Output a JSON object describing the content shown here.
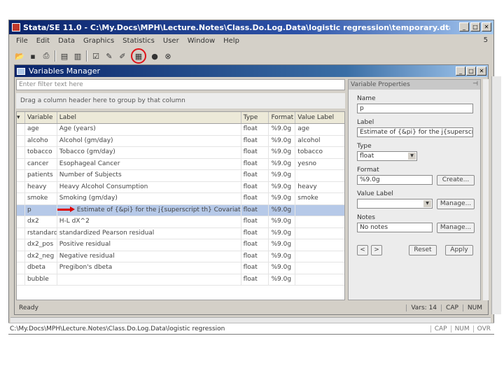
{
  "window": {
    "title": "Stata/SE 11.0 - C:\\My.Docs\\MPH\\Lecture.Notes\\Class.Do.Log.Data\\logistic regression\\temporary.dta -...",
    "page_number": "5"
  },
  "menu": [
    "File",
    "Edit",
    "Data",
    "Graphics",
    "Statistics",
    "User",
    "Window",
    "Help"
  ],
  "vm": {
    "title": "Variables Manager",
    "filter_placeholder": "Enter filter text here",
    "group_hint": "Drag a column header here to group by that column",
    "columns": [
      "Variable",
      "Label",
      "Type",
      "Format",
      "Value Label"
    ],
    "rows": [
      {
        "var": "age",
        "label": "Age (years)",
        "type": "float",
        "format": "%9.0g",
        "vl": "age"
      },
      {
        "var": "alcoho",
        "label": "Alcohol (gm/day)",
        "type": "float",
        "format": "%9.0g",
        "vl": "alcohol"
      },
      {
        "var": "tobacco",
        "label": "Tobacco (gm/day)",
        "type": "float",
        "format": "%9.0g",
        "vl": "tobacco"
      },
      {
        "var": "cancer",
        "label": "Esophageal Cancer",
        "type": "float",
        "format": "%9.0g",
        "vl": "yesno"
      },
      {
        "var": "patients",
        "label": "Number of Subjects",
        "type": "float",
        "format": "%9.0g",
        "vl": ""
      },
      {
        "var": "heavy",
        "label": "Heavy Alcohol Consumption",
        "type": "float",
        "format": "%9.0g",
        "vl": "heavy"
      },
      {
        "var": "smoke",
        "label": "Smoking (gm/day)",
        "type": "float",
        "format": "%9.0g",
        "vl": "smoke"
      },
      {
        "var": "p",
        "label": "Estimate of {&pi} for the j{superscript th} Covariate Pattern",
        "type": "float",
        "format": "%9.0g",
        "vl": ""
      },
      {
        "var": "dx2",
        "label": "H-L dX^2",
        "type": "float",
        "format": "%9.0g",
        "vl": ""
      },
      {
        "var": "rstandard",
        "label": "standardized Pearson residual",
        "type": "float",
        "format": "%9.0g",
        "vl": ""
      },
      {
        "var": "dx2_pos",
        "label": "Positive residual",
        "type": "float",
        "format": "%9.0g",
        "vl": ""
      },
      {
        "var": "dx2_neg",
        "label": "Negative residual",
        "type": "float",
        "format": "%9.0g",
        "vl": ""
      },
      {
        "var": "dbeta",
        "label": "Pregibon's dbeta",
        "type": "float",
        "format": "%9.0g",
        "vl": ""
      },
      {
        "var": "bubble",
        "label": "",
        "type": "float",
        "format": "%9.0g",
        "vl": ""
      }
    ]
  },
  "props": {
    "title": "Variable Properties",
    "name_label": "Name",
    "name_value": "p",
    "label_label": "Label",
    "label_value": "Estimate of {&pi} for the j{superscript th} Co",
    "type_label": "Type",
    "type_value": "float",
    "format_label": "Format",
    "format_value": "%9.0g",
    "create_btn": "Create...",
    "vl_label": "Value Label",
    "vl_value": "",
    "manage_btn": "Manage...",
    "notes_label": "Notes",
    "notes_value": "No notes",
    "prev": "<",
    "next": ">",
    "reset": "Reset",
    "apply": "Apply"
  },
  "status": {
    "ready": "Ready",
    "vars": "Vars: 14",
    "cap": "CAP",
    "num": "NUM"
  },
  "pathbar": {
    "path": "C:\\My.Docs\\MPH\\Lecture.Notes\\Class.Do.Log.Data\\logistic regression",
    "cap": "CAP",
    "num": "NUM",
    "ovr": "OVR"
  }
}
